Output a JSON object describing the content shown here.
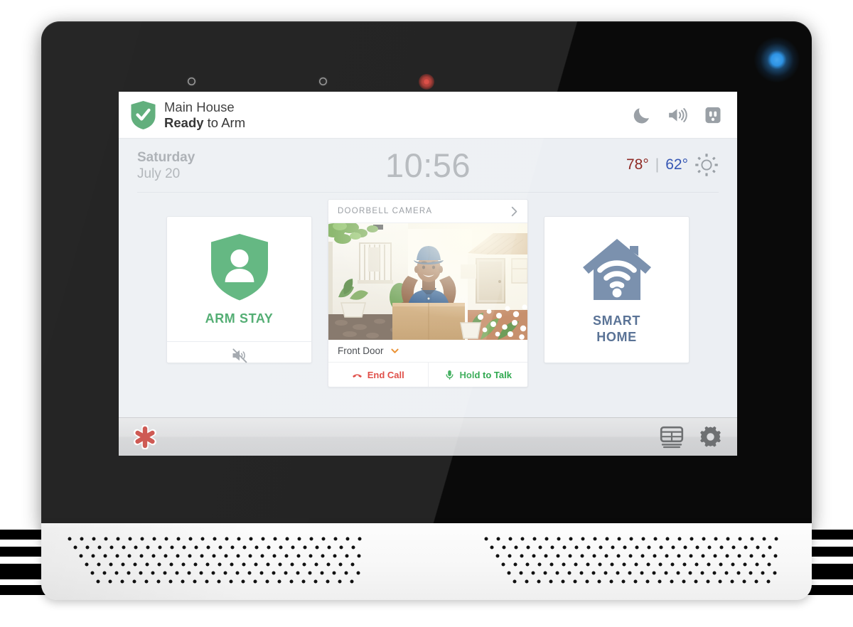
{
  "device": {
    "name": "smart-home-security-touchscreen-panel",
    "bezel_color": "#0a0a0a",
    "base_color": "#fbfbfb",
    "status_led_color": "#2e93e4",
    "camera_led_color": "#d83c33"
  },
  "screen": {
    "background": "#eceff3",
    "header": {
      "shield_icon": "shield-check-icon",
      "shield_color": "#4ea56d",
      "location": "Main House",
      "status_strong": "Ready",
      "status_rest": " to Arm",
      "icons": [
        {
          "name": "moon-icon",
          "label": "Night Mode"
        },
        {
          "name": "volume-icon",
          "label": "Volume"
        },
        {
          "name": "outlet-icon",
          "label": "Power Outlet"
        }
      ],
      "icon_color": "#9aa0a6"
    },
    "info_bar": {
      "day_of_week": "Saturday",
      "date": "July 20",
      "time": "10:56",
      "weather": {
        "high": "78°",
        "separator": "|",
        "low": "62°",
        "high_color": "#8f2a24",
        "low_color": "#3657b4",
        "condition_icon": "sun-icon"
      }
    },
    "tiles": {
      "arm_stay": {
        "icon": "shield-person-icon",
        "label": "ARM STAY",
        "accent": "#3fa463",
        "footer_icon": "volume-mute-icon"
      },
      "doorbell_camera": {
        "header_label": "DOORBELL CAMERA",
        "header_chevron": "chevron-right-icon",
        "video_alt": "delivery-person-holding-box-at-front-door",
        "source_label": "Front Door",
        "source_chevron": "chevron-down-icon",
        "source_chevron_color": "#e8861e",
        "end_call_label": "End Call",
        "end_call_icon": "phone-hangup-icon",
        "end_call_color": "#dc3a33",
        "talk_label": "Hold to Talk",
        "talk_icon": "microphone-icon",
        "talk_color": "#2fa84f"
      },
      "smart_home": {
        "icon": "house-wifi-icon",
        "label_line1": "SMART",
        "label_line2": "HOME",
        "accent": "#5a7396"
      }
    },
    "nav_bar": {
      "panic_icon": "emergency-asterisk-icon",
      "panic_color": "#c8453f",
      "right_icons": [
        {
          "name": "keypad-icon",
          "label": "Keypad"
        },
        {
          "name": "gear-icon",
          "label": "Settings"
        }
      ],
      "icon_color": "#6e7072"
    }
  }
}
